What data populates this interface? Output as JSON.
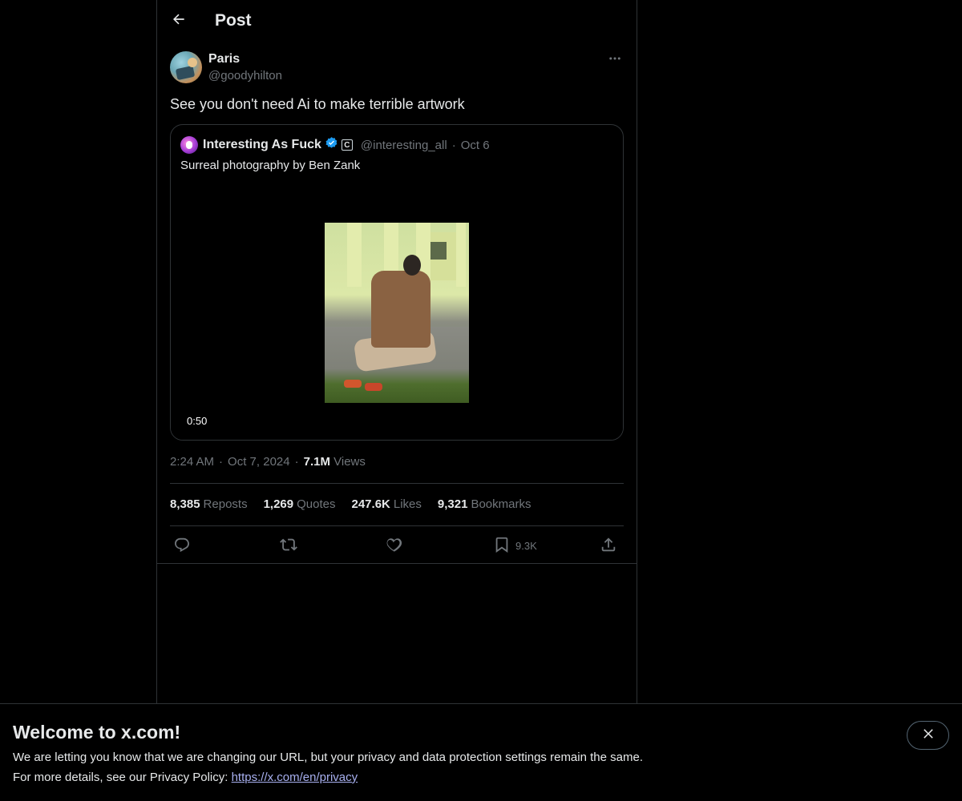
{
  "header": {
    "title": "Post",
    "back_icon": "arrow-left-icon"
  },
  "post": {
    "author_name": "Paris",
    "author_handle": "@goodyhilton",
    "more_icon": "more-horizontal-icon",
    "text": "See you don't need Ai to make terrible artwork",
    "quote": {
      "name": "Interesting As Fuck",
      "verified_icon": "verified-badge-icon",
      "badge": "C",
      "handle": "@interesting_all",
      "separator": "·",
      "date": "Oct 6",
      "text": "Surreal photography by Ben Zank",
      "video_duration": "0:50"
    },
    "time": "2:24 AM",
    "separator": "·",
    "date": "Oct 7, 2024",
    "views_count": "7.1M",
    "views_label": "Views",
    "stats": {
      "reposts_count": "8,385",
      "reposts_label": "Reposts",
      "quotes_count": "1,269",
      "quotes_label": "Quotes",
      "likes_count": "247.6K",
      "likes_label": "Likes",
      "bookmarks_count": "9,321",
      "bookmarks_label": "Bookmarks"
    },
    "actions": {
      "reply_icon": "reply-icon",
      "repost_icon": "repost-icon",
      "like_icon": "heart-icon",
      "bookmark_icon": "bookmark-icon",
      "bookmark_count": "9.3K",
      "share_icon": "share-icon"
    }
  },
  "banner": {
    "title": "Welcome to x.com!",
    "line1": "We are letting you know that we are changing our URL, but your privacy and data protection settings remain the same.",
    "line2_prefix": "For more details, see our Privacy Policy: ",
    "link": "https://x.com/en/privacy",
    "close_icon": "close-icon"
  },
  "colors": {
    "background": "#000000",
    "text": "#e7e9ea",
    "muted": "#71767b",
    "border": "#2f3336",
    "verified": "#1d9bf0",
    "link": "#a8b0f0"
  }
}
